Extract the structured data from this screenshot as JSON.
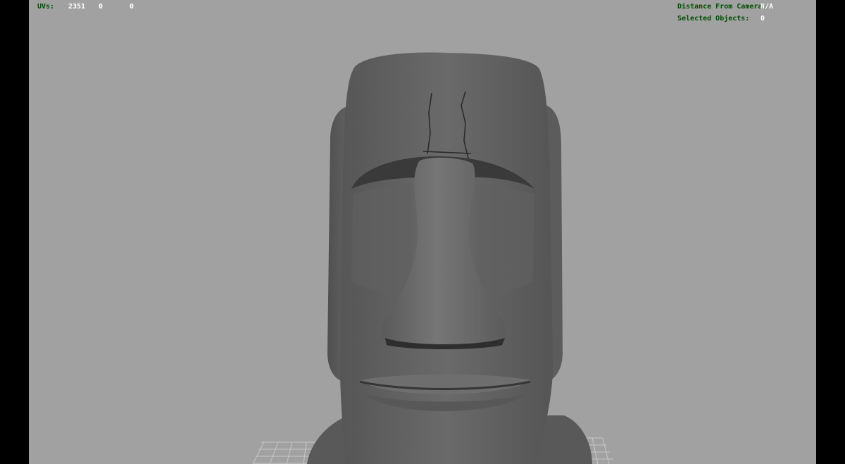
{
  "hud": {
    "uvs_label": "UVs:",
    "uvs_value": "2351",
    "uvs_col2": "0",
    "uvs_col3": "0",
    "distance_label": "Distance From Camera:",
    "distance_value": "N/A",
    "selected_label": "Selected Objects:",
    "selected_value": "0"
  },
  "viewport": {
    "background": "#a1a1a1",
    "model": "moai-head-mesh",
    "grid": "ground-grid"
  },
  "colors": {
    "hud_label": "#004f00",
    "hud_value": "#ffffff",
    "mesh": "#5e5e5e"
  }
}
